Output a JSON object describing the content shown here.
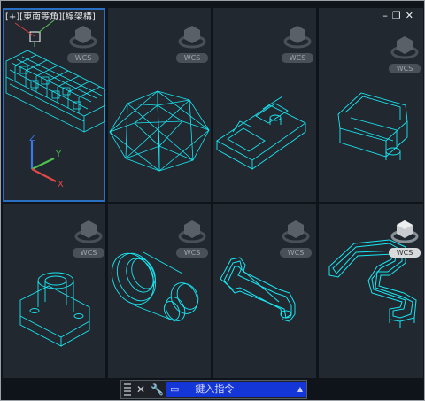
{
  "viewport_label": "[+][東南等角][線架構]",
  "window_controls": [
    "–",
    "❐",
    "✕"
  ],
  "wcs_label": "WCS",
  "command_bar": {
    "prompt": "鍵入指令",
    "close_glyph": "✕",
    "wrench_glyph": "🔧",
    "recent_glyph": "▭",
    "dropdown_glyph": "▲"
  },
  "colors": {
    "wire": "#19e6f2",
    "viewport_bg": "#212830",
    "active_border": "#2b6fc2",
    "command_input": "#1536d6"
  }
}
